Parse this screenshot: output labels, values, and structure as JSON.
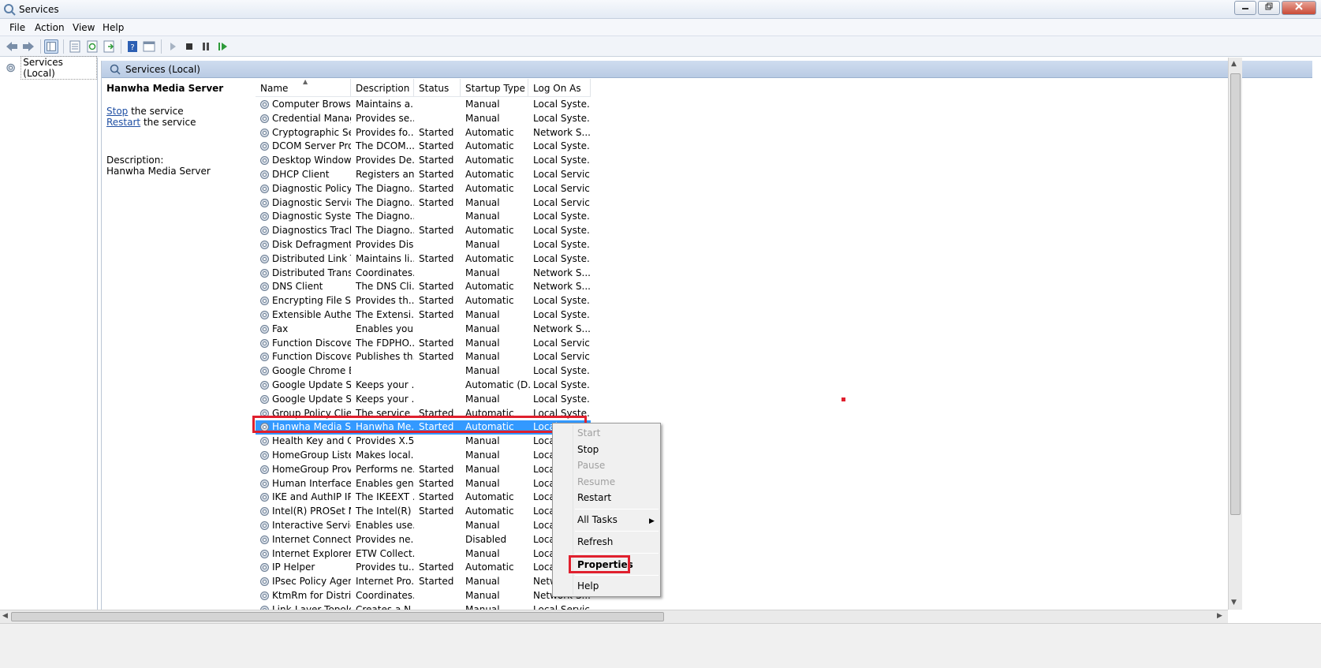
{
  "window": {
    "title": "Services",
    "min": "0",
    "max": "1",
    "close": "r"
  },
  "menu": {
    "file": "File",
    "action": "Action",
    "view": "View",
    "help": "Help"
  },
  "tree": {
    "root": "Services (Local)"
  },
  "content_header": {
    "title": "Services (Local)"
  },
  "extended": {
    "service_name": "Hanwha Media Server",
    "stop_link": "Stop",
    "stop_suffix": " the service",
    "restart_link": "Restart",
    "restart_suffix": " the service",
    "desc_label": "Description:",
    "desc_value": "Hanwha Media Server"
  },
  "columns": {
    "name": "Name",
    "description": "Description",
    "status": "Status",
    "startup": "Startup Type",
    "logon": "Log On As"
  },
  "services": [
    {
      "name": "Computer Browser",
      "desc": "Maintains a...",
      "status": "",
      "startup": "Manual",
      "logon": "Local Syste..."
    },
    {
      "name": "Credential Manager",
      "desc": "Provides se...",
      "status": "",
      "startup": "Manual",
      "logon": "Local Syste..."
    },
    {
      "name": "Cryptographic Ser...",
      "desc": "Provides fo...",
      "status": "Started",
      "startup": "Automatic",
      "logon": "Network S..."
    },
    {
      "name": "DCOM Server Pro...",
      "desc": "The DCOM...",
      "status": "Started",
      "startup": "Automatic",
      "logon": "Local Syste..."
    },
    {
      "name": "Desktop Window ...",
      "desc": "Provides De...",
      "status": "Started",
      "startup": "Automatic",
      "logon": "Local Syste..."
    },
    {
      "name": "DHCP Client",
      "desc": "Registers an...",
      "status": "Started",
      "startup": "Automatic",
      "logon": "Local Service"
    },
    {
      "name": "Diagnostic Policy ...",
      "desc": "The Diagno...",
      "status": "Started",
      "startup": "Automatic",
      "logon": "Local Service"
    },
    {
      "name": "Diagnostic Service...",
      "desc": "The Diagno...",
      "status": "Started",
      "startup": "Manual",
      "logon": "Local Service"
    },
    {
      "name": "Diagnostic System...",
      "desc": "The Diagno...",
      "status": "",
      "startup": "Manual",
      "logon": "Local Syste..."
    },
    {
      "name": "Diagnostics Tracki...",
      "desc": "The Diagno...",
      "status": "Started",
      "startup": "Automatic",
      "logon": "Local Syste..."
    },
    {
      "name": "Disk Defragmenter",
      "desc": "Provides Dis...",
      "status": "",
      "startup": "Manual",
      "logon": "Local Syste..."
    },
    {
      "name": "Distributed Link Tr...",
      "desc": "Maintains li...",
      "status": "Started",
      "startup": "Automatic",
      "logon": "Local Syste..."
    },
    {
      "name": "Distributed Transa...",
      "desc": "Coordinates...",
      "status": "",
      "startup": "Manual",
      "logon": "Network S..."
    },
    {
      "name": "DNS Client",
      "desc": "The DNS Cli...",
      "status": "Started",
      "startup": "Automatic",
      "logon": "Network S..."
    },
    {
      "name": "Encrypting File Sy...",
      "desc": "Provides th...",
      "status": "Started",
      "startup": "Automatic",
      "logon": "Local Syste..."
    },
    {
      "name": "Extensible Authen...",
      "desc": "The Extensi...",
      "status": "Started",
      "startup": "Manual",
      "logon": "Local Syste..."
    },
    {
      "name": "Fax",
      "desc": "Enables you...",
      "status": "",
      "startup": "Manual",
      "logon": "Network S..."
    },
    {
      "name": "Function Discover...",
      "desc": "The FDPHO...",
      "status": "Started",
      "startup": "Manual",
      "logon": "Local Service"
    },
    {
      "name": "Function Discover...",
      "desc": "Publishes th...",
      "status": "Started",
      "startup": "Manual",
      "logon": "Local Service"
    },
    {
      "name": "Google Chrome El...",
      "desc": "",
      "status": "",
      "startup": "Manual",
      "logon": "Local Syste..."
    },
    {
      "name": "Google Update Se...",
      "desc": "Keeps your ...",
      "status": "",
      "startup": "Automatic (D...",
      "logon": "Local Syste..."
    },
    {
      "name": "Google Update Se...",
      "desc": "Keeps your ...",
      "status": "",
      "startup": "Manual",
      "logon": "Local Syste..."
    },
    {
      "name": "Group Policy Client",
      "desc": "The service ...",
      "status": "Started",
      "startup": "Automatic",
      "logon": "Local Syste..."
    },
    {
      "name": "Hanwha Media Se...",
      "desc": "Hanwha Me...",
      "status": "Started",
      "startup": "Automatic",
      "logon": "Local Syste..."
    },
    {
      "name": "Health Key and Ce...",
      "desc": "Provides X.5...",
      "status": "",
      "startup": "Manual",
      "logon": "Local Syste..."
    },
    {
      "name": "HomeGroup Liste...",
      "desc": "Makes local...",
      "status": "",
      "startup": "Manual",
      "logon": "Local Syste..."
    },
    {
      "name": "HomeGroup Provi...",
      "desc": "Performs ne...",
      "status": "Started",
      "startup": "Manual",
      "logon": "Local Service"
    },
    {
      "name": "Human Interface ...",
      "desc": "Enables gen...",
      "status": "Started",
      "startup": "Manual",
      "logon": "Local Syste..."
    },
    {
      "name": "IKE and AuthIP IPs...",
      "desc": "The IKEEXT ...",
      "status": "Started",
      "startup": "Automatic",
      "logon": "Local Syste..."
    },
    {
      "name": "Intel(R) PROSet M...",
      "desc": "The Intel(R) ...",
      "status": "Started",
      "startup": "Automatic",
      "logon": "Local Syste..."
    },
    {
      "name": "Interactive Service...",
      "desc": "Enables use...",
      "status": "",
      "startup": "Manual",
      "logon": "Local Syste..."
    },
    {
      "name": "Internet Connecti...",
      "desc": "Provides ne...",
      "status": "",
      "startup": "Disabled",
      "logon": "Local Syste..."
    },
    {
      "name": "Internet Explorer E...",
      "desc": "ETW Collect...",
      "status": "",
      "startup": "Manual",
      "logon": "Local Syste..."
    },
    {
      "name": "IP Helper",
      "desc": "Provides tu...",
      "status": "Started",
      "startup": "Automatic",
      "logon": "Local Syste..."
    },
    {
      "name": "IPsec Policy Agent",
      "desc": "Internet Pro...",
      "status": "Started",
      "startup": "Manual",
      "logon": "Network S..."
    },
    {
      "name": "KtmRm for Distrib...",
      "desc": "Coordinates...",
      "status": "",
      "startup": "Manual",
      "logon": "Network S..."
    },
    {
      "name": "Link-Layer Topolo...",
      "desc": "Creates a N...",
      "status": "",
      "startup": "Manual",
      "logon": "Local Service"
    }
  ],
  "context_menu": {
    "start": "Start",
    "stop": "Stop",
    "pause": "Pause",
    "resume": "Resume",
    "restart": "Restart",
    "all_tasks": "All Tasks",
    "refresh": "Refresh",
    "properties": "Properties",
    "help": "Help"
  },
  "accent_colors": {
    "selection": "#3399ff",
    "highlight": "#e0202e",
    "link": "#1f4fa3"
  }
}
